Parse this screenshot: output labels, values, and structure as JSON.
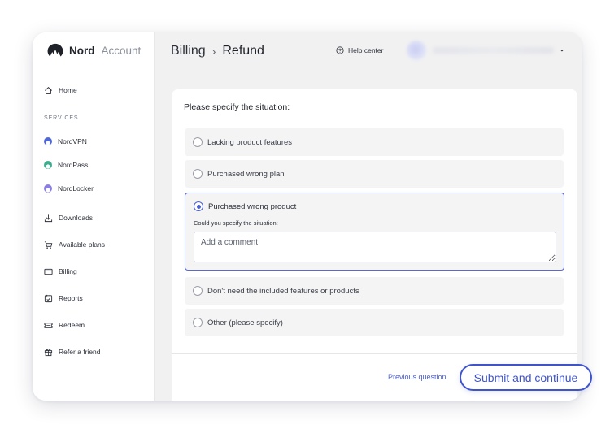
{
  "brand": {
    "name": "Nord",
    "sub": "Account"
  },
  "sidebar": {
    "home_label": "Home",
    "section_label": "SERVICES",
    "products": [
      {
        "label": "NordVPN",
        "color": "#4f67d8"
      },
      {
        "label": "NordPass",
        "color": "#3fae8f"
      },
      {
        "label": "NordLocker",
        "color": "#8a7fe0"
      }
    ],
    "items": [
      {
        "label": "Downloads",
        "icon": "download-icon"
      },
      {
        "label": "Available plans",
        "icon": "cart-icon"
      },
      {
        "label": "Billing",
        "icon": "credit-card-icon"
      },
      {
        "label": "Reports",
        "icon": "reports-icon"
      },
      {
        "label": "Redeem",
        "icon": "ticket-icon"
      },
      {
        "label": "Refer a friend",
        "icon": "gift-icon"
      }
    ]
  },
  "header": {
    "breadcrumb_parent": "Billing",
    "breadcrumb_sep": "›",
    "breadcrumb_current": "Refund",
    "help_label": "Help center"
  },
  "form": {
    "title": "Please specify the situation:",
    "options": [
      {
        "label": "Lacking product features",
        "selected": false
      },
      {
        "label": "Purchased wrong plan",
        "selected": false
      },
      {
        "label": "Purchased wrong product",
        "selected": true
      },
      {
        "label": "Don't need the included features or products",
        "selected": false
      },
      {
        "label": "Other (please specify)",
        "selected": false
      }
    ],
    "sub_label": "Could you specify the situation:",
    "comment_placeholder": "Add a comment",
    "comment_value": ""
  },
  "footer": {
    "prev_label": "Previous question",
    "submit_label": "Submit and continue"
  },
  "colors": {
    "accent": "#3f54cc",
    "selected_border": "#5a68d1"
  }
}
